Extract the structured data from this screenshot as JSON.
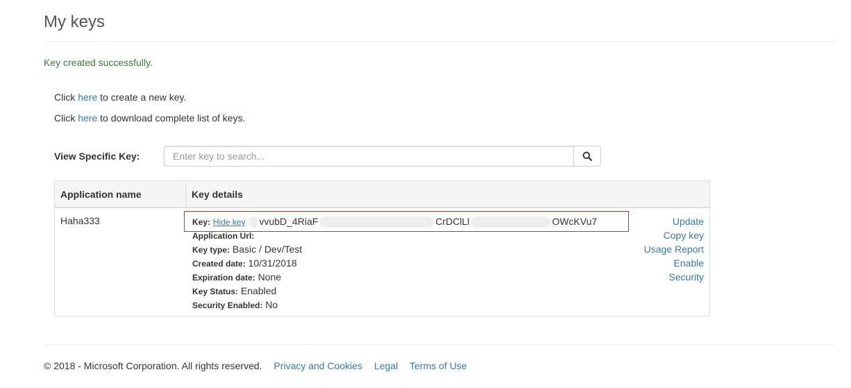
{
  "page": {
    "title": "My keys"
  },
  "status": {
    "success_message": "Key created successfully."
  },
  "links": {
    "create": {
      "prefix": "Click",
      "link": "here",
      "suffix": "to create a new key."
    },
    "download": {
      "prefix": "Click",
      "link": "here",
      "suffix": "to download complete list of keys."
    }
  },
  "search": {
    "label": "View Specific Key:",
    "placeholder": "Enter key to search...",
    "value": "",
    "button_icon": "search-icon"
  },
  "table": {
    "headers": [
      "Application name",
      "Key details"
    ],
    "rows": [
      {
        "app_name": "Haha333",
        "key_label": "Key:",
        "hide_key_link": "Hide key",
        "key_parts": [
          "vvubD_4RiaF",
          "CrDClLl",
          "OWcKVu7"
        ],
        "details": [
          {
            "label": "Application Url:",
            "value": ""
          },
          {
            "label": "Key type:",
            "value": "Basic / Dev/Test"
          },
          {
            "label": "Created date:",
            "value": "10/31/2018"
          },
          {
            "label": "Expiration date:",
            "value": "None"
          },
          {
            "label": "Key Status:",
            "value": "Enabled"
          },
          {
            "label": "Security Enabled:",
            "value": "No"
          }
        ],
        "actions": [
          "Update",
          "Copy key",
          "Usage Report",
          "Enable",
          "Security"
        ]
      }
    ]
  },
  "footer": {
    "copyright": "© 2018 - Microsoft Corporation. All rights reserved.",
    "links": [
      "Privacy and Cookies",
      "Legal",
      "Terms of Use"
    ]
  },
  "colors": {
    "link": "#337ab7",
    "success": "#3c763d",
    "highlight_border": "#c9302c",
    "table_border": "#dddddd"
  }
}
